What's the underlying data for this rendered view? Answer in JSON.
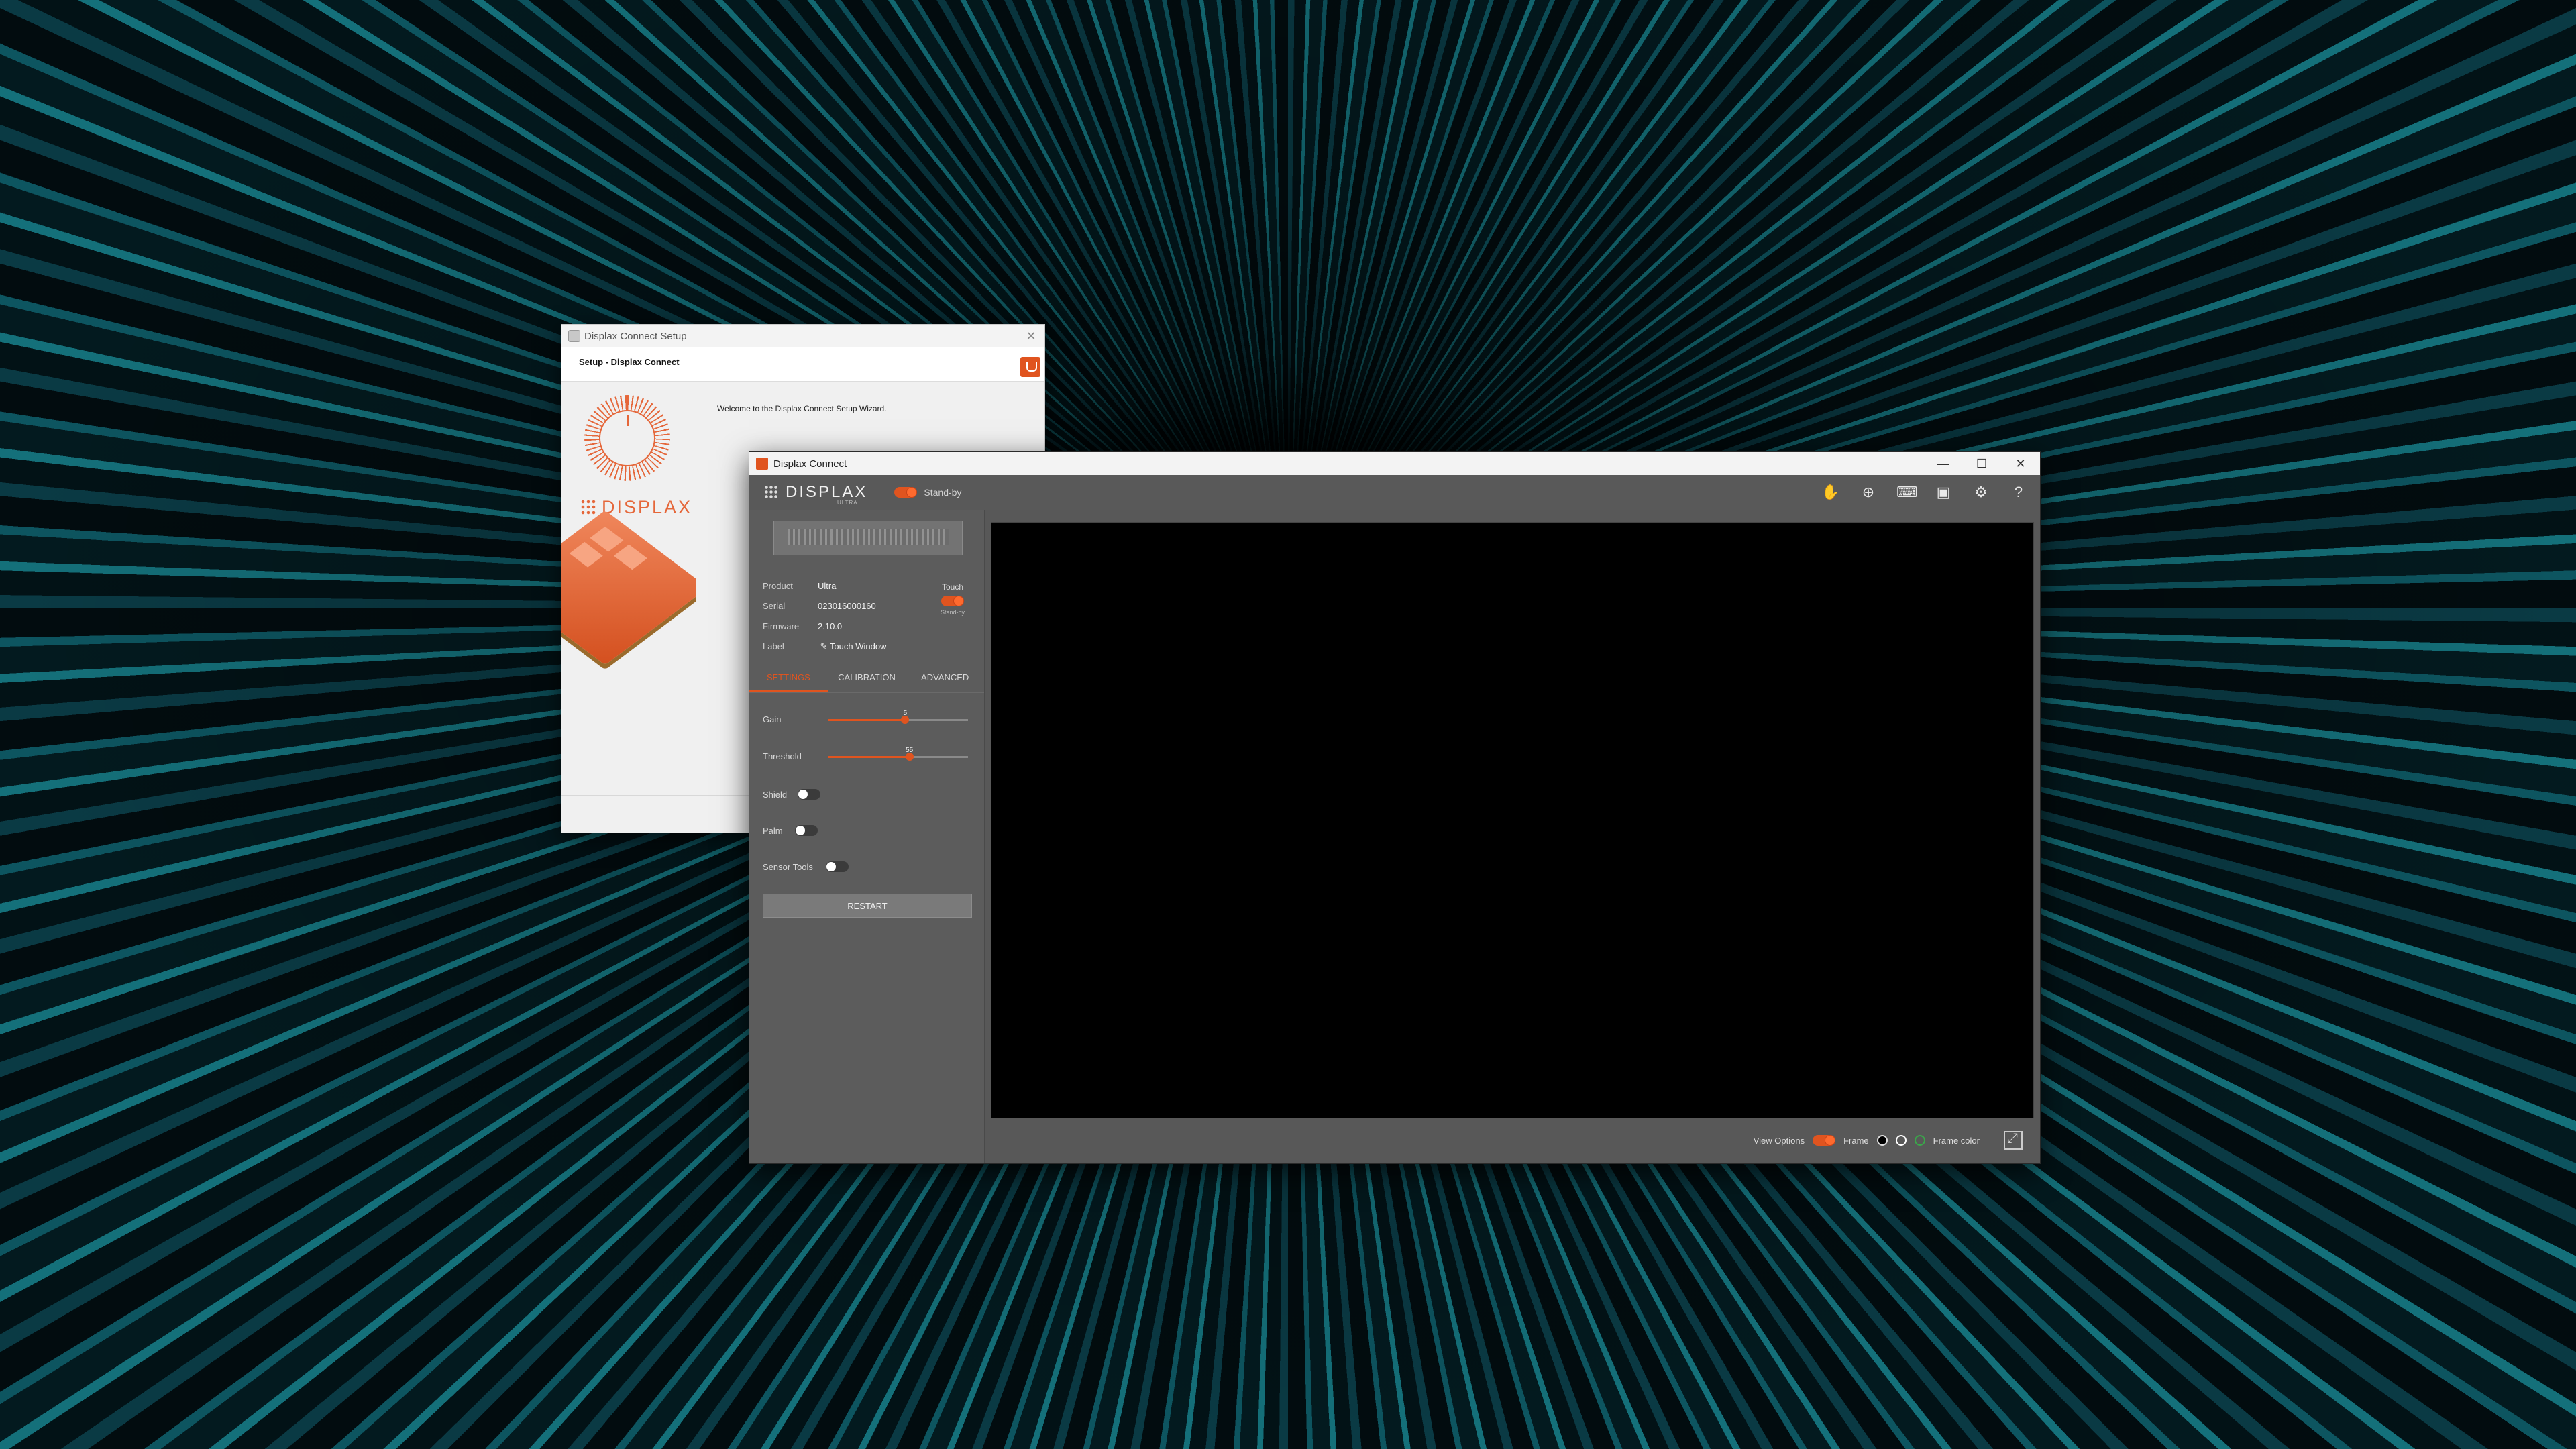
{
  "setup": {
    "title": "Displax Connect Setup",
    "header_title": "Setup - Displax Connect",
    "brand": "DISPLAX",
    "welcome": "Welcome to the Displax Connect Setup Wizard.",
    "close": "✕"
  },
  "main": {
    "title": "Displax Connect",
    "window_buttons": {
      "minimize": "—",
      "maximize": "☐",
      "close": "✕"
    },
    "logo": "DISPLAX",
    "logo_sub": "ULTRA",
    "standby_label": "Stand-by",
    "toolbar_icons": [
      "hand-icon",
      "support-icon",
      "keyboard-icon",
      "display-icon",
      "gear-icon",
      "help-icon"
    ],
    "device": {
      "product_label": "Product",
      "product": "Ultra",
      "serial_label": "Serial",
      "serial": "023016000160",
      "firmware_label": "Firmware",
      "firmware": "2.10.0",
      "label_label": "Label",
      "label": "Touch Window",
      "touch_label": "Touch",
      "touch_state": "Stand-by"
    },
    "tabs": [
      "SETTINGS",
      "CALIBRATION",
      "ADVANCED"
    ],
    "active_tab": 0,
    "settings": {
      "gain_label": "Gain",
      "gain_value": "5",
      "gain_fraction": 0.55,
      "threshold_label": "Threshold",
      "threshold_value": "55",
      "threshold_fraction": 0.58,
      "shield_label": "Shield",
      "shield_on": false,
      "palm_label": "Palm",
      "palm_on": false,
      "sensor_tools_label": "Sensor Tools",
      "sensor_tools_on": false,
      "restart_label": "RESTART"
    },
    "view_options": {
      "label": "View Options",
      "frame_label": "Frame",
      "frame_color_label": "Frame color",
      "colors": [
        "#000000",
        "#ffffff",
        "#3aa84a"
      ]
    },
    "accent": "#e0541f"
  }
}
